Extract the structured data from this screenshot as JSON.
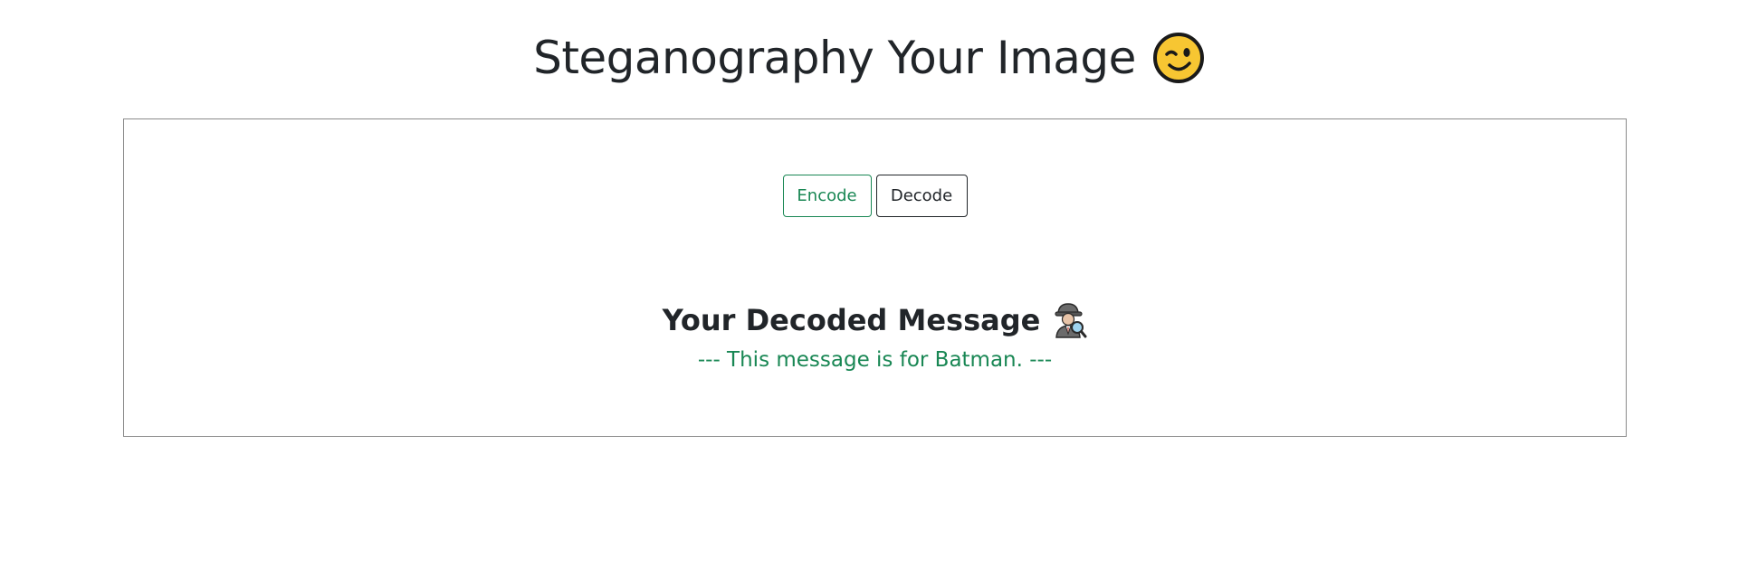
{
  "header": {
    "title": "Steganography Your Image",
    "title_icon": "winking-face-icon"
  },
  "tabs": {
    "encode_label": "Encode",
    "decode_label": "Decode",
    "active_color": "#198754",
    "inactive_color": "#212529"
  },
  "result": {
    "heading": "Your Decoded Message",
    "heading_icon": "detective-icon",
    "message": "--- This message is for Batman. ---",
    "message_color": "#198754"
  }
}
